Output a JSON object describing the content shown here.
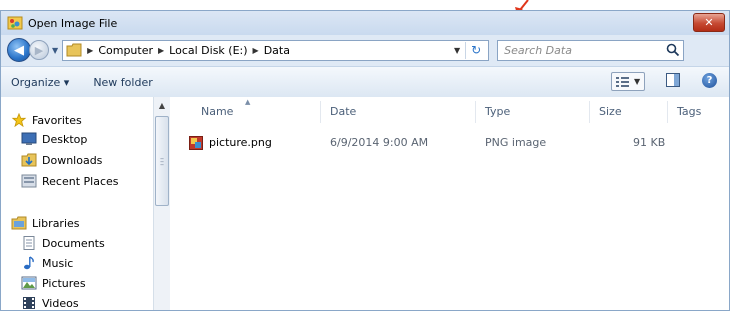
{
  "window": {
    "title": "Open Image File"
  },
  "address": {
    "crumbs": [
      "Computer",
      "Local Disk (E:)",
      "Data"
    ]
  },
  "search": {
    "placeholder": "Search Data"
  },
  "toolbar": {
    "organize_label": "Organize ▾",
    "new_folder_label": "New folder"
  },
  "nav": {
    "favorites_label": "Favorites",
    "favorites": [
      "Desktop",
      "Downloads",
      "Recent Places"
    ],
    "libraries_label": "Libraries",
    "libraries": [
      "Documents",
      "Music",
      "Pictures",
      "Videos"
    ]
  },
  "columns": [
    "Name",
    "Date",
    "Type",
    "Size",
    "Tags"
  ],
  "files": [
    {
      "name": "picture.png",
      "date": "6/9/2014 9:00 AM",
      "type": "PNG image",
      "size": "91 KB"
    }
  ],
  "colors": {
    "accent": "#1e395b",
    "arrow": "#e0361b",
    "close": "#c64a33"
  }
}
